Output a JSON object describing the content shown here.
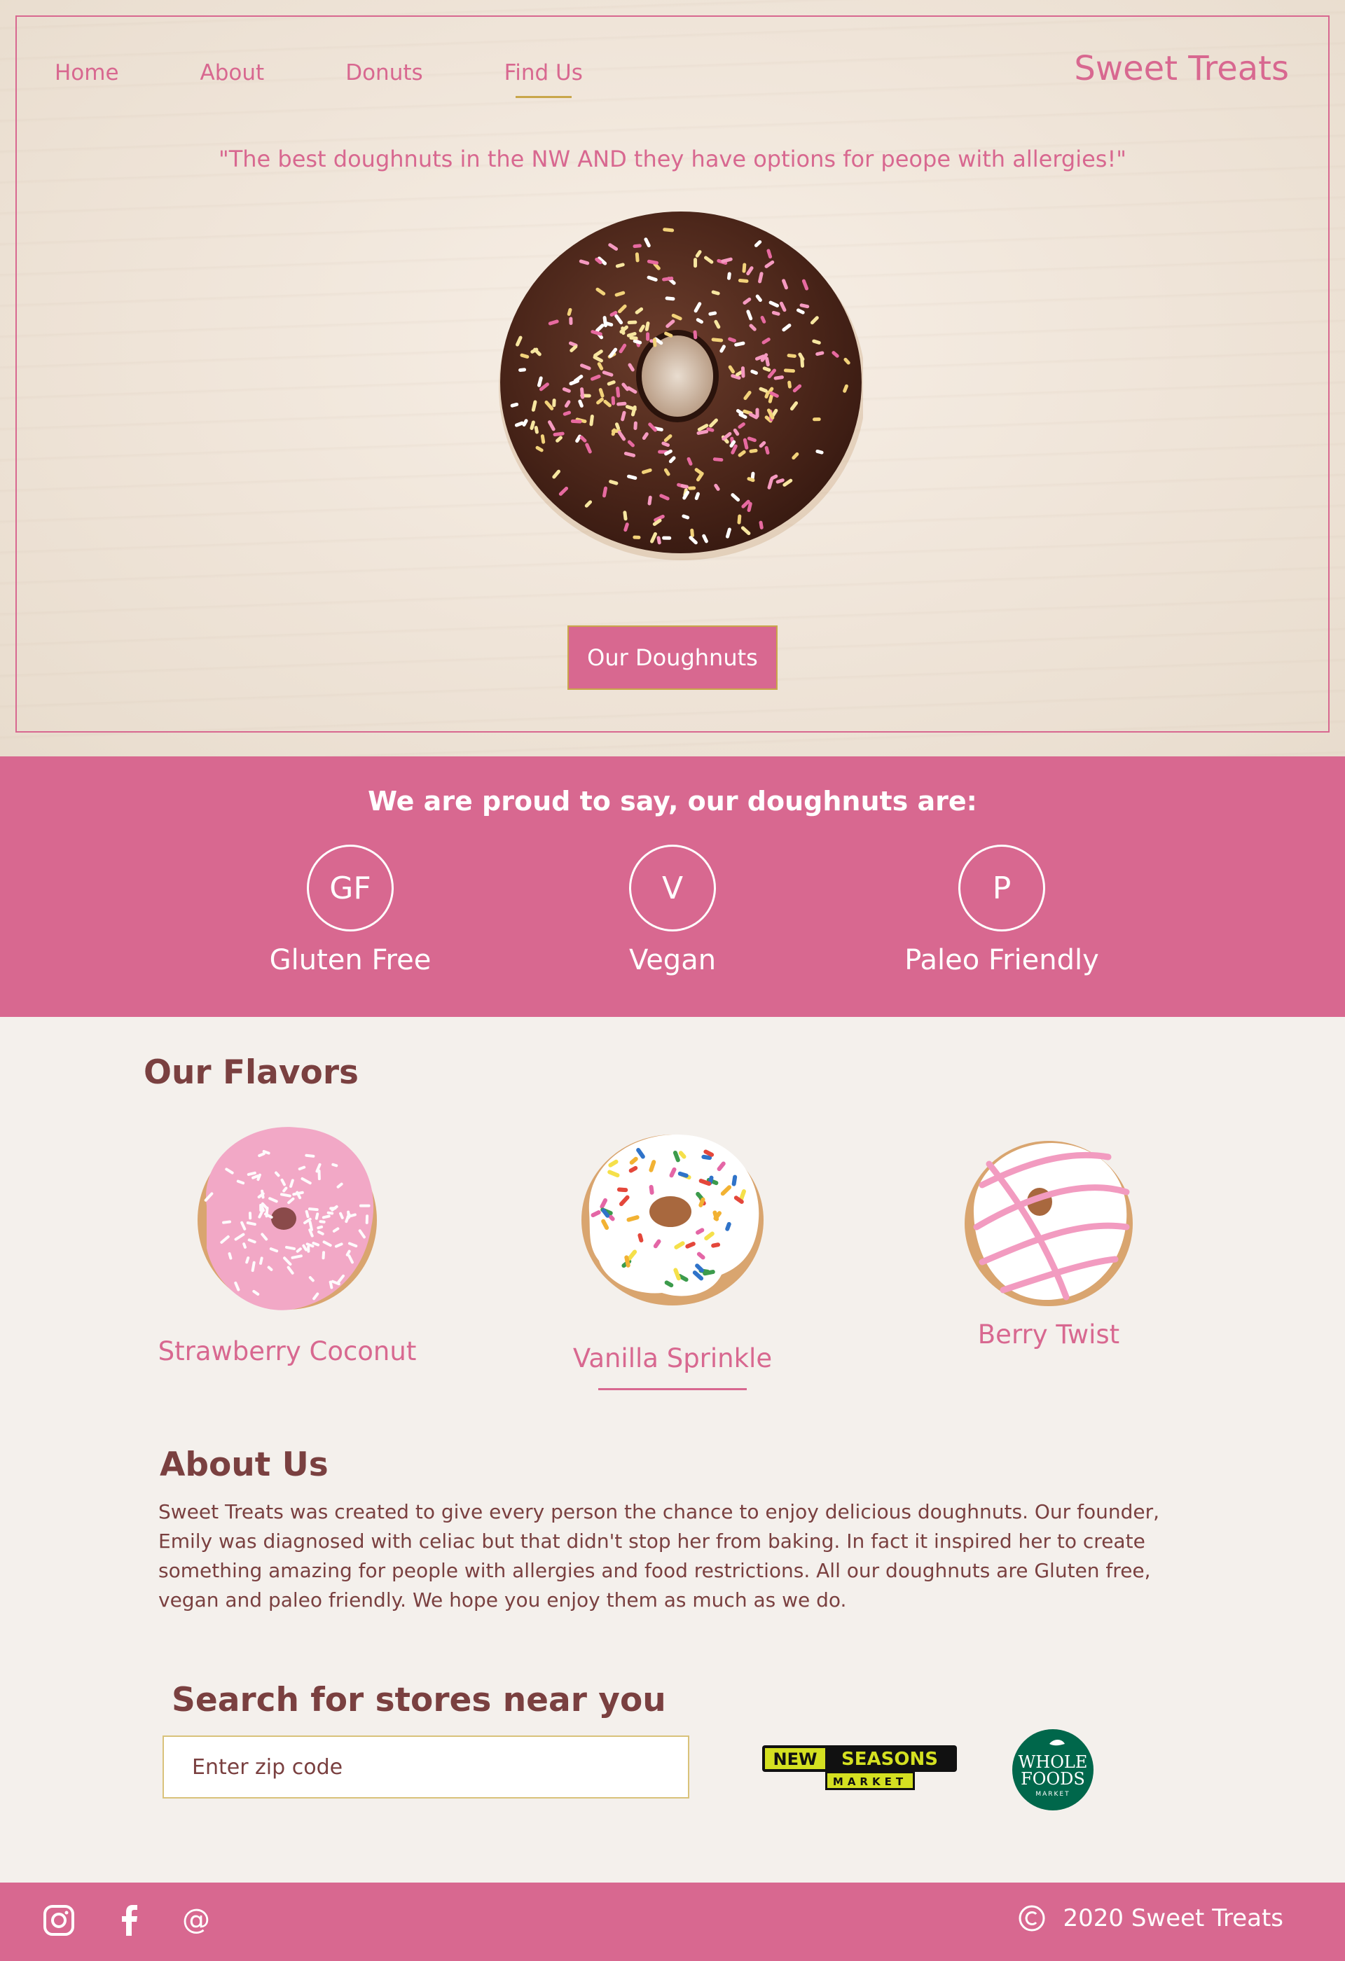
{
  "nav": {
    "items": [
      "Home",
      "About",
      "Donuts",
      "Find Us"
    ],
    "active": "Find Us"
  },
  "brand": "Sweet Treats",
  "hero": {
    "quote": "\"The best doughnuts in the NW AND they have options for peope with allergies!\"",
    "cta_label": "Our Doughnuts"
  },
  "proud": {
    "title": "We are proud to say, our doughnuts are:",
    "badges": [
      {
        "abbr": "GF",
        "label": "Gluten Free"
      },
      {
        "abbr": "V",
        "label": "Vegan"
      },
      {
        "abbr": "P",
        "label": "Paleo Friendly"
      }
    ]
  },
  "flavors": {
    "heading": "Our Flavors",
    "items": [
      {
        "name": "Strawberry Coconut",
        "icon": "strawberry-coconut-donut-image"
      },
      {
        "name": "Vanilla Sprinkle",
        "icon": "vanilla-sprinkle-donut-image"
      },
      {
        "name": "Berry Twist",
        "icon": "berry-twist-donut-image"
      }
    ],
    "active": "Vanilla Sprinkle"
  },
  "about": {
    "heading": "About Us",
    "text": "Sweet Treats was created to give every person the chance to enjoy delicious doughnuts. Our founder, Emily was diagnosed with celiac but that didn't stop her from baking. In fact it inspired her to create something amazing for people with allergies and food restrictions. All our doughnuts are Gluten free, vegan and paleo friendly. We hope you enjoy them as much as we do."
  },
  "search": {
    "heading": "Search for stores near you",
    "placeholder": "Enter zip code",
    "value": "",
    "stores": [
      {
        "name_line1": "NEW SEASONS",
        "name_line2": "MARKET",
        "icon": "new-seasons-logo"
      },
      {
        "name_line1": "WHOLE",
        "name_line2": "FOODS",
        "name_line3": "MARKET",
        "icon": "whole-foods-logo"
      }
    ]
  },
  "footer": {
    "social_icons": [
      "instagram-icon",
      "facebook-icon",
      "at-icon"
    ],
    "copyright_symbol": "©",
    "copyright": "2020 Sweet Treats"
  },
  "colors": {
    "brand_pink": "#d86890",
    "accent_gold": "#c9a64a",
    "text_brown": "#7a4040",
    "page_bg": "#f4f0ec"
  }
}
